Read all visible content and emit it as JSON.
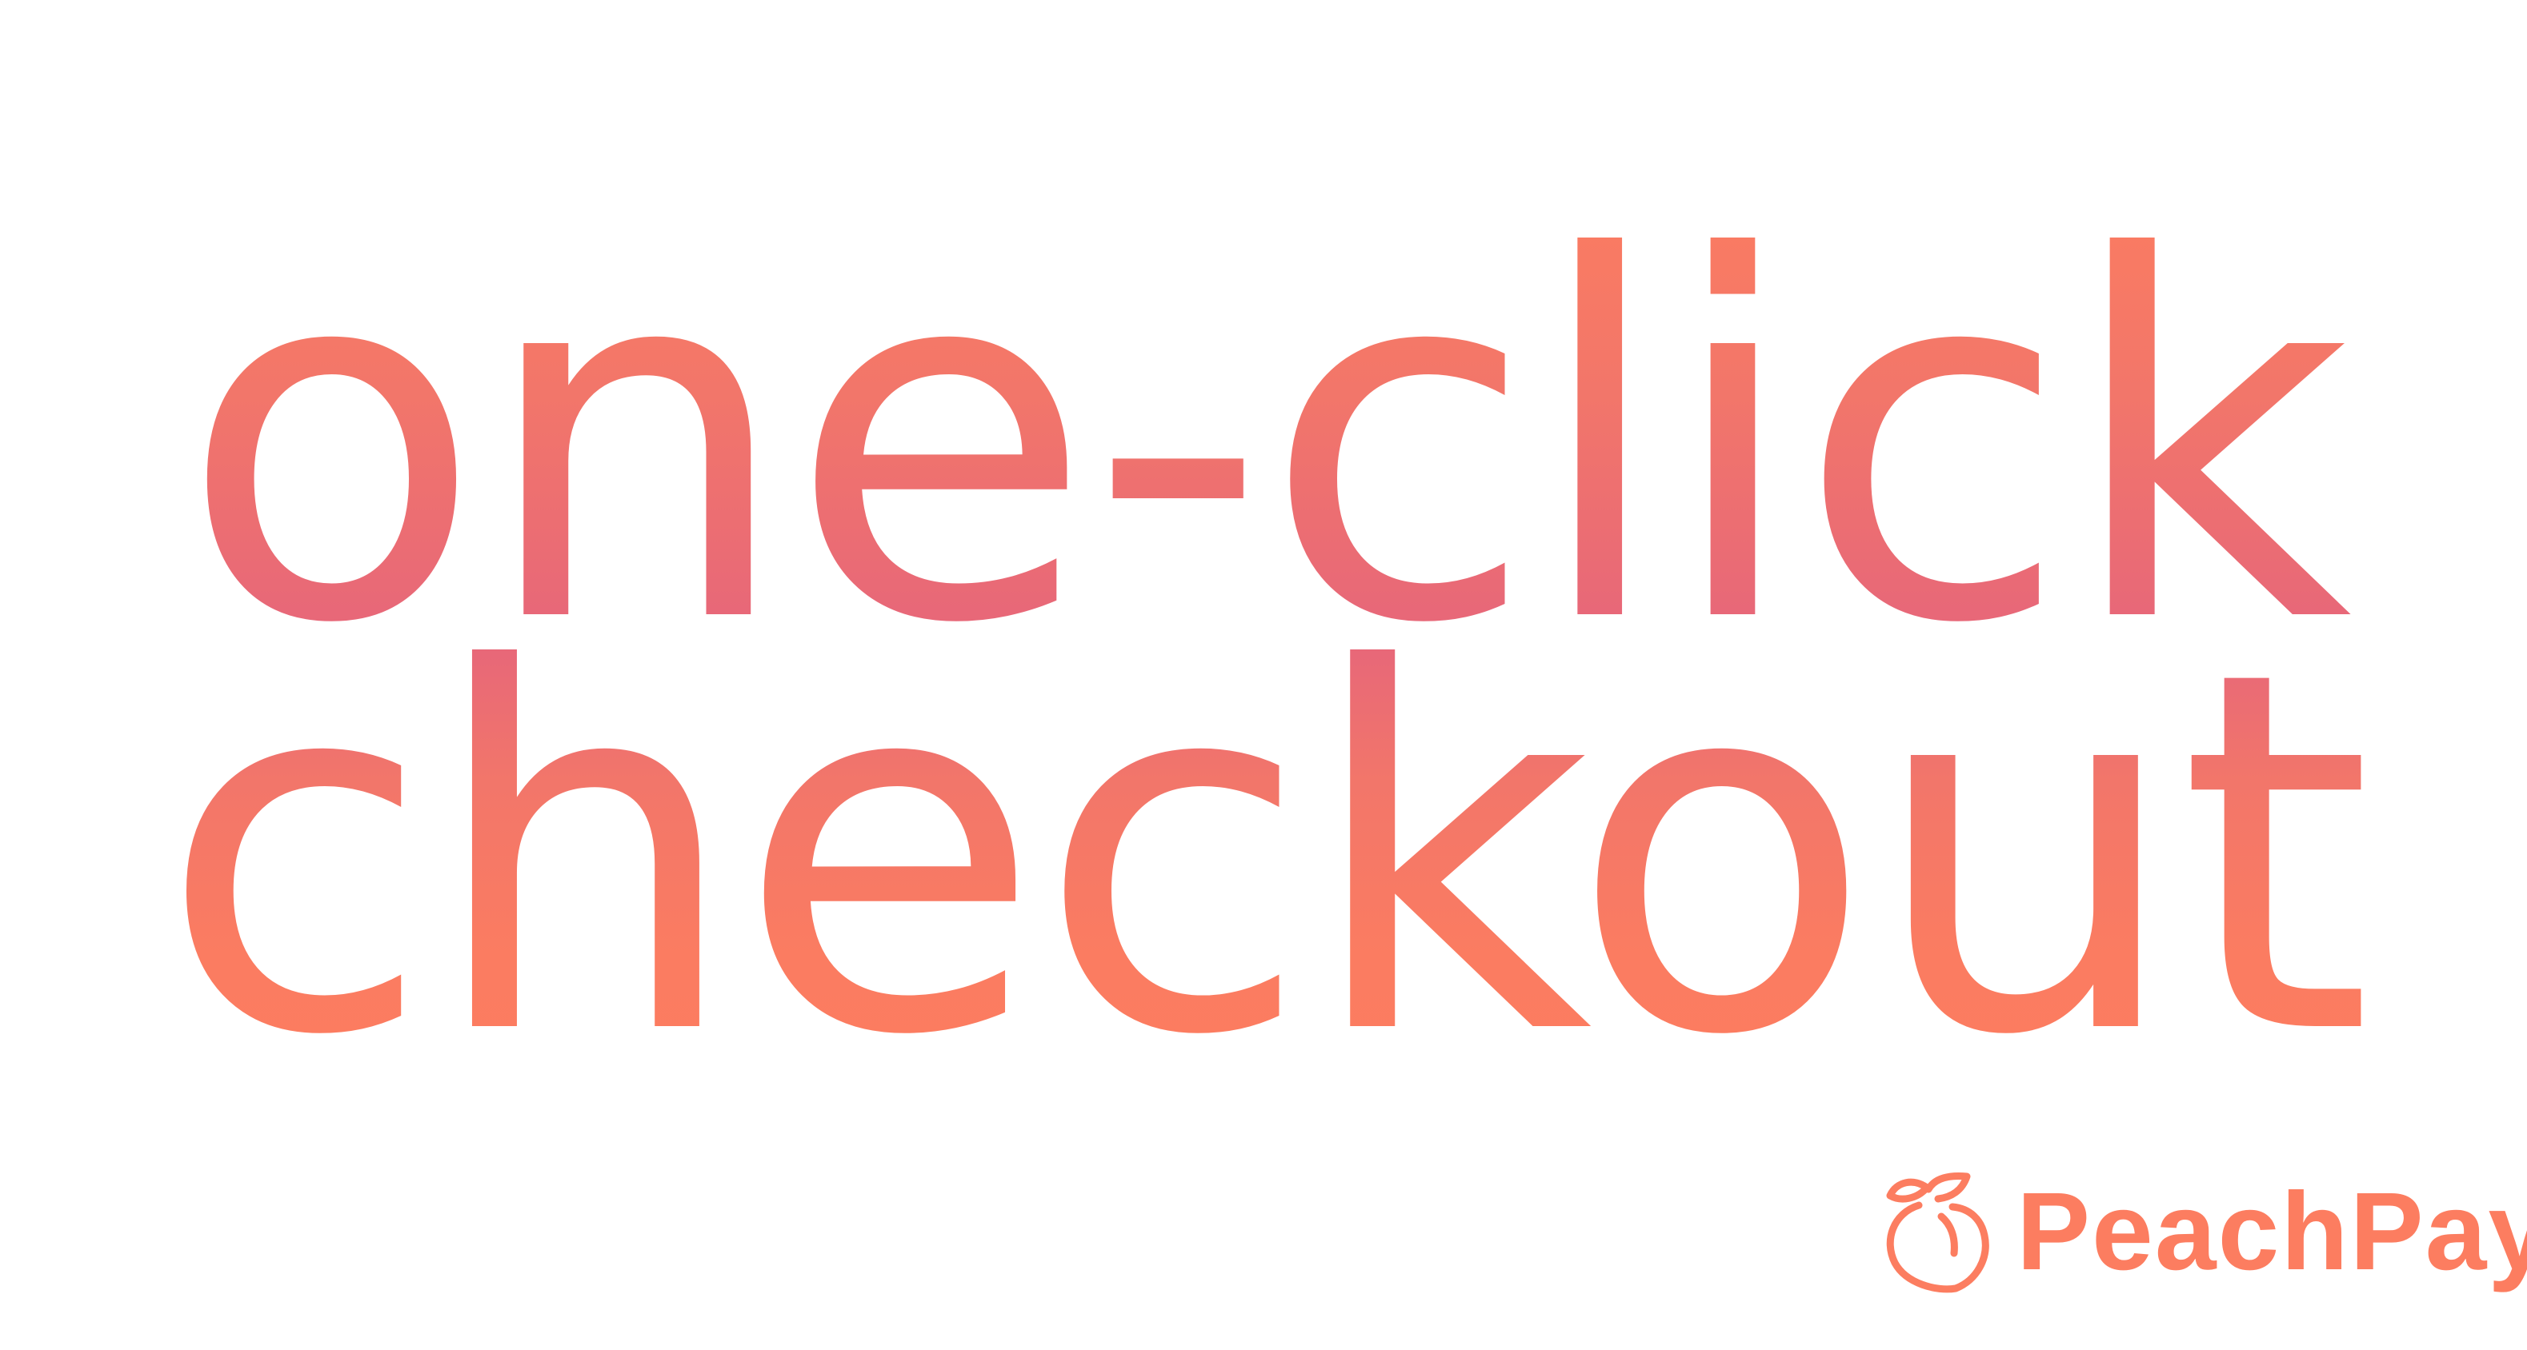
{
  "headline": {
    "line_1": "one-click",
    "line_2": "checkout"
  },
  "logo": {
    "icon": "peach-icon",
    "wordmark": "PeachPay"
  },
  "colors": {
    "background": "#ffffff",
    "gradient_coral": "#fc7d60",
    "gradient_mid": "#f2766a",
    "gradient_pink": "#e4637d",
    "brand": "#fc7d60"
  }
}
